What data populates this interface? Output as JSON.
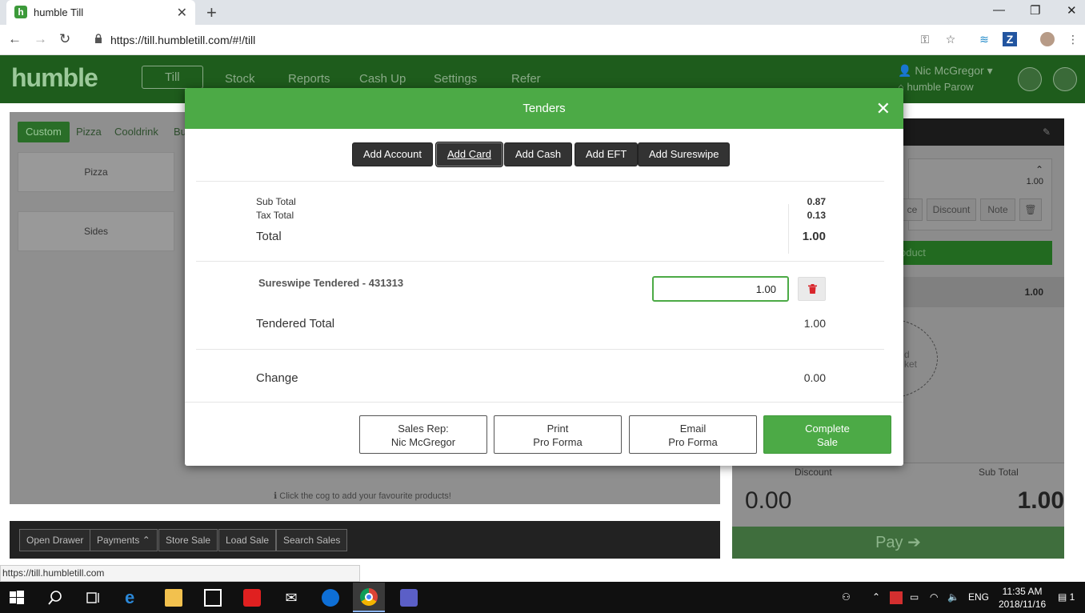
{
  "browser": {
    "tab_title": "humble Till",
    "url": "https://till.humbletill.com/#!/till",
    "status_url": "https://till.humbletill.com"
  },
  "app": {
    "logo": "humble",
    "nav": [
      "Till",
      "Stock",
      "Reports",
      "Cash Up",
      "Settings",
      "Refer"
    ],
    "user_name": "Nic McGregor",
    "store_name": "humble Parow"
  },
  "left": {
    "categories": [
      "Custom",
      "Pizza",
      "Cooldrink",
      "Bu"
    ],
    "tiles": [
      "Pizza",
      "Sides"
    ],
    "hint": "Click the cog to add your favourite products!"
  },
  "bottom_bar": [
    "Open Drawer",
    "Payments",
    "Store Sale",
    "Load Sale",
    "Search Sales"
  ],
  "right": {
    "qty": "1.00",
    "buttons": [
      "ce",
      "Discount",
      "Note"
    ],
    "green_label": "oduct",
    "line_total": "1.00",
    "basket_text_1": "d",
    "basket_text_2": "ket",
    "discount_label": "Discount",
    "subtotal_label": "Sub Total",
    "discount_value": "0.00",
    "subtotal_value": "1.00",
    "pay_label": "Pay"
  },
  "modal": {
    "title": "Tenders",
    "add_buttons": [
      "Add Account",
      "Add Card",
      "Add Cash",
      "Add EFT",
      "Add Sureswipe"
    ],
    "subtotal_label": "Sub Total",
    "subtotal_value": "0.87",
    "tax_label": "Tax Total",
    "tax_value": "0.13",
    "total_label": "Total",
    "total_value": "1.00",
    "tender_label": "Sureswipe Tendered - 431313",
    "tender_amount": "1.00",
    "tendered_total_label": "Tendered Total",
    "tendered_total_value": "1.00",
    "change_label": "Change",
    "change_value": "0.00",
    "footer": {
      "sales_rep_line1": "Sales Rep:",
      "sales_rep_line2": "Nic McGregor",
      "print_line1": "Print",
      "print_line2": "Pro Forma",
      "email_line1": "Email",
      "email_line2": "Pro Forma",
      "complete_line1": "Complete",
      "complete_line2": "Sale"
    }
  },
  "taskbar": {
    "lang": "ENG",
    "time": "11:35 AM",
    "date": "2018/11/16",
    "notif_count": "1"
  },
  "colors": {
    "brand_green": "#4caa46",
    "appbar_green": "#1e5c1c",
    "danger_red": "#d9262c"
  }
}
